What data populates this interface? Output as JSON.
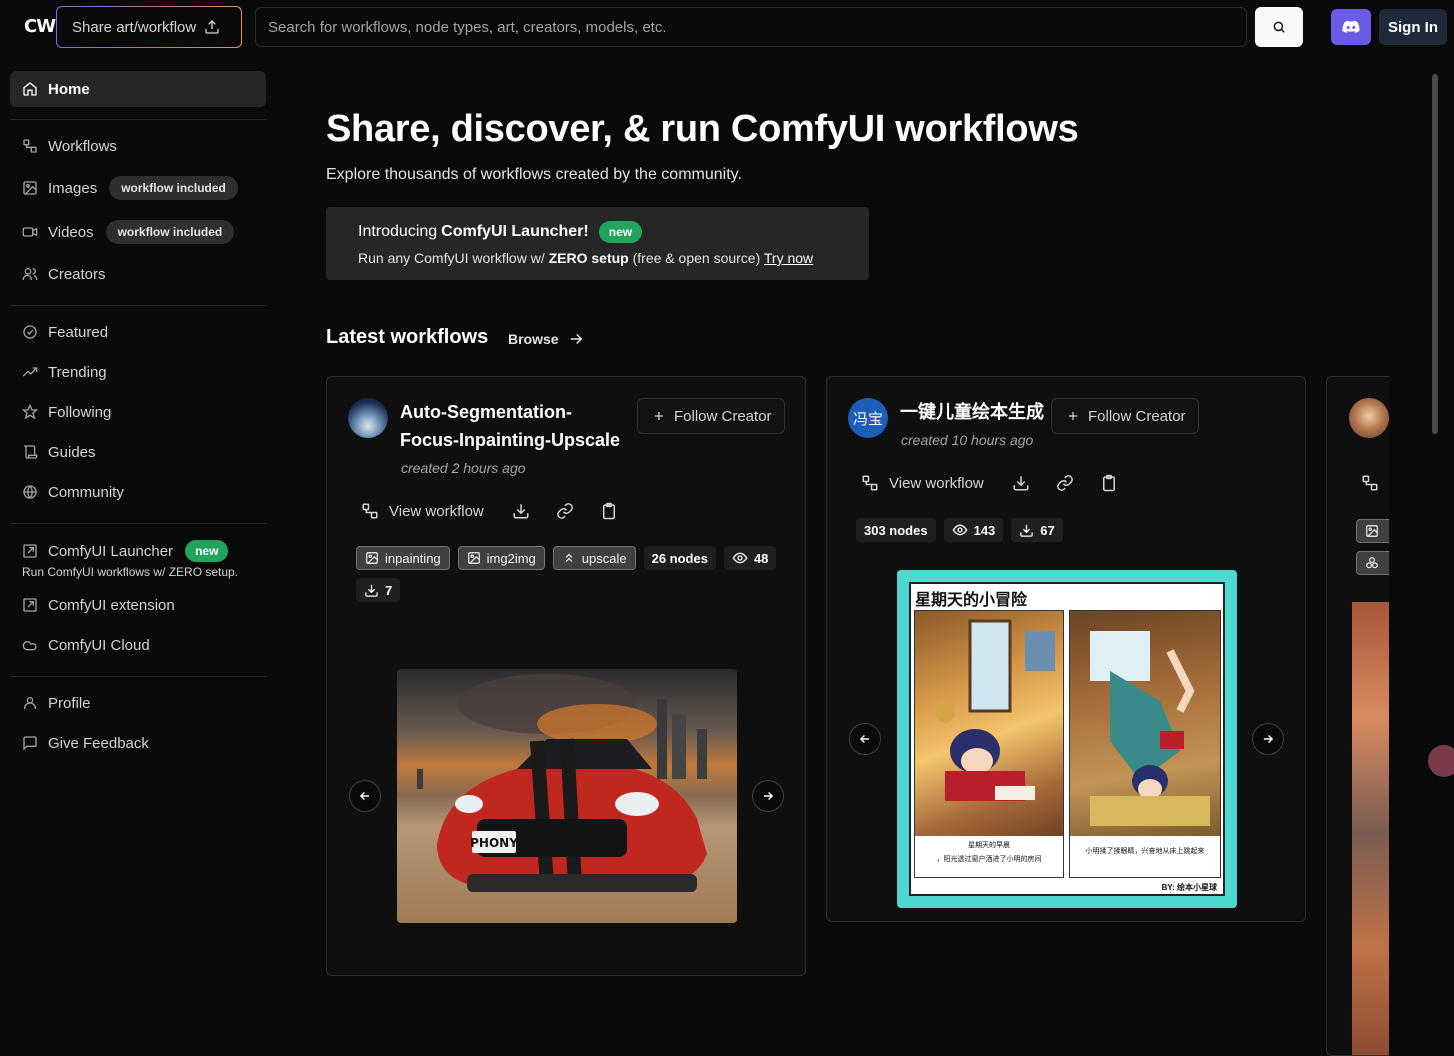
{
  "header": {
    "logo": "CW",
    "share_label": "Share art/workflow",
    "search_placeholder": "Search for workflows, node types, art, creators, models, etc.",
    "signin_label": "Sign In"
  },
  "sidebar": {
    "home": "Home",
    "workflows": "Workflows",
    "images": "Images",
    "images_badge": "workflow included",
    "videos": "Videos",
    "videos_badge": "workflow included",
    "creators": "Creators",
    "featured": "Featured",
    "trending": "Trending",
    "following": "Following",
    "guides": "Guides",
    "community": "Community",
    "launcher": "ComfyUI Launcher",
    "launcher_badge": "new",
    "launcher_sub": "Run ComfyUI workflows w/ ZERO setup.",
    "extension": "ComfyUI extension",
    "cloud": "ComfyUI Cloud",
    "profile": "Profile",
    "feedback": "Give Feedback"
  },
  "hero": {
    "title": "Share, discover, & run ComfyUI workflows",
    "subtitle": "Explore thousands of workflows created by the community."
  },
  "intro": {
    "prefix": "Introducing",
    "product": "ComfyUI Launcher!",
    "badge": "new",
    "line2_a": "Run any ComfyUI workflow w/",
    "line2_b": "ZERO setup",
    "line2_c": "(free & open source)",
    "try_now": "Try now"
  },
  "latest": {
    "title": "Latest workflows",
    "browse": "Browse"
  },
  "cards": [
    {
      "title_line1": "Auto-Segmentation-",
      "title_line2": "Focus-Inpainting-Upscale",
      "created": "created 2 hours ago",
      "follow": "Follow Creator",
      "view": "View workflow",
      "tags": [
        "inpainting",
        "img2img",
        "upscale"
      ],
      "nodes": "26 nodes",
      "views": "48",
      "downloads": "7",
      "image_plate": "PHONY"
    },
    {
      "title": "一键儿童绘本生成",
      "avatar_text": "冯宝",
      "created": "created 10 hours ago",
      "follow": "Follow Creator",
      "view": "View workflow",
      "nodes": "303 nodes",
      "views": "143",
      "downloads": "67",
      "book_title": "星期天的小冒险",
      "book_caption_left_1": "星期天的早晨",
      "book_caption_left_2": "，阳光透过窗户洒进了小明的房间",
      "book_caption_right": "小明揉了揉眼睛，兴奋地从床上跳起来",
      "book_signature": "BY: 绘本小星球"
    }
  ],
  "colors": {
    "background": "#0a0a0a",
    "accent_green": "#22a45d",
    "discord": "#6b5ce7",
    "book_border": "#4fd8cf"
  }
}
